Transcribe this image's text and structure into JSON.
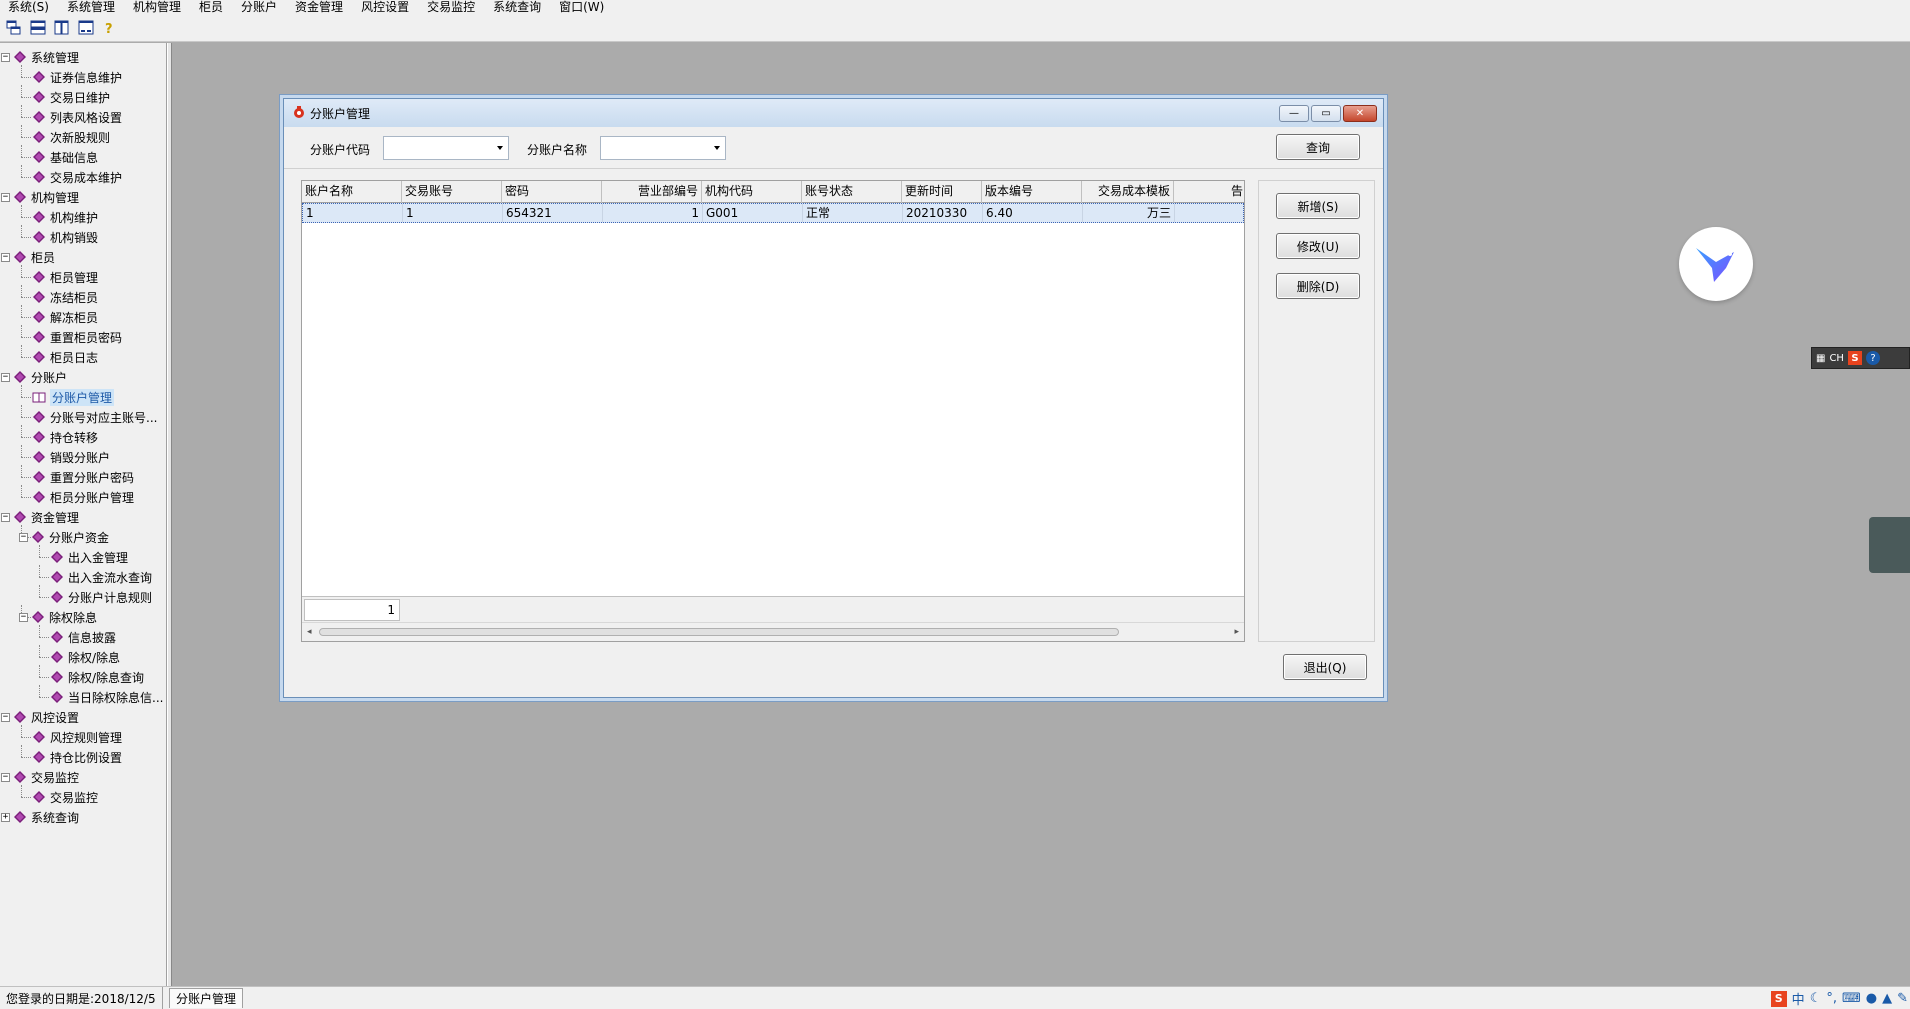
{
  "menubar": {
    "items": [
      {
        "label": "系统(S)"
      },
      {
        "label": "系统管理"
      },
      {
        "label": "机构管理"
      },
      {
        "label": "柜员"
      },
      {
        "label": "分账户"
      },
      {
        "label": "资金管理"
      },
      {
        "label": "风控设置"
      },
      {
        "label": "交易监控"
      },
      {
        "label": "系统查询"
      },
      {
        "label": "窗口(W)"
      }
    ]
  },
  "toolbar": {
    "icons": [
      "cascade-windows-icon",
      "tile-horizontal-icon",
      "tile-vertical-icon",
      "arrange-icons-icon",
      "help-icon"
    ]
  },
  "tree": {
    "items": [
      {
        "label": "系统管理",
        "level": 0,
        "expanded": true
      },
      {
        "label": "证券信息维护",
        "level": 1
      },
      {
        "label": "交易日维护",
        "level": 1
      },
      {
        "label": "列表风格设置",
        "level": 1
      },
      {
        "label": "次新股规则",
        "level": 1
      },
      {
        "label": "基础信息",
        "level": 1
      },
      {
        "label": "交易成本维护",
        "level": 1
      },
      {
        "label": "机构管理",
        "level": 0,
        "expanded": true
      },
      {
        "label": "机构维护",
        "level": 1
      },
      {
        "label": "机构销毁",
        "level": 1
      },
      {
        "label": "柜员",
        "level": 0,
        "expanded": true
      },
      {
        "label": "柜员管理",
        "level": 1
      },
      {
        "label": "冻结柜员",
        "level": 1
      },
      {
        "label": "解冻柜员",
        "level": 1
      },
      {
        "label": "重置柜员密码",
        "level": 1
      },
      {
        "label": "柜员日志",
        "level": 1
      },
      {
        "label": "分账户",
        "level": 0,
        "expanded": true
      },
      {
        "label": "分账户管理",
        "level": 1,
        "selected": true
      },
      {
        "label": "分账号对应主账号...",
        "level": 1
      },
      {
        "label": "持仓转移",
        "level": 1
      },
      {
        "label": "销毁分账户",
        "level": 1
      },
      {
        "label": "重置分账户密码",
        "level": 1
      },
      {
        "label": "柜员分账户管理",
        "level": 1
      },
      {
        "label": "资金管理",
        "level": 0,
        "expanded": true
      },
      {
        "label": "分账户资金",
        "level": 1,
        "expanded": true
      },
      {
        "label": "出入金管理",
        "level": 2
      },
      {
        "label": "出入金流水查询",
        "level": 2
      },
      {
        "label": "分账户计息规则",
        "level": 2
      },
      {
        "label": "除权除息",
        "level": 1,
        "expanded": true
      },
      {
        "label": "信息披露",
        "level": 2
      },
      {
        "label": "除权/除息",
        "level": 2
      },
      {
        "label": "除权/除息查询",
        "level": 2
      },
      {
        "label": "当日除权除息信...",
        "level": 2
      },
      {
        "label": "风控设置",
        "level": 0,
        "expanded": true
      },
      {
        "label": "风控规则管理",
        "level": 1
      },
      {
        "label": "持仓比例设置",
        "level": 1
      },
      {
        "label": "交易监控",
        "level": 0,
        "expanded": true
      },
      {
        "label": "交易监控",
        "level": 1
      },
      {
        "label": "系统查询",
        "level": 0,
        "expanded": false
      }
    ]
  },
  "dialog": {
    "title": "分账户管理",
    "search": {
      "code_label": "分账户代码",
      "code_value": "",
      "name_label": "分账户名称",
      "name_value": "",
      "query_button": "查询"
    },
    "grid": {
      "columns": [
        "账户名称",
        "交易账号",
        "密码",
        "营业部编号",
        "机构代码",
        "账号状态",
        "更新时间",
        "版本编号",
        "交易成本模板",
        "告"
      ],
      "rows": [
        [
          "1",
          "1",
          "654321",
          "1",
          "G001",
          "正常",
          "20210330",
          "6.40",
          "万三",
          ""
        ]
      ],
      "row_count": "1"
    },
    "buttons": {
      "add": "新增(S)",
      "edit": "修改(U)",
      "delete": "删除(D)",
      "exit": "退出(Q)"
    }
  },
  "ime_toolbar": {
    "lang": "CH"
  },
  "statusbar": {
    "login_date": "您登录的日期是:2018/12/5",
    "window_tab": "分账户管理",
    "ime_mode": "中"
  },
  "colors": {
    "accent": "#1e5aa8",
    "tree_icon": "#7a1f7a",
    "selection": "#dce8f7"
  }
}
